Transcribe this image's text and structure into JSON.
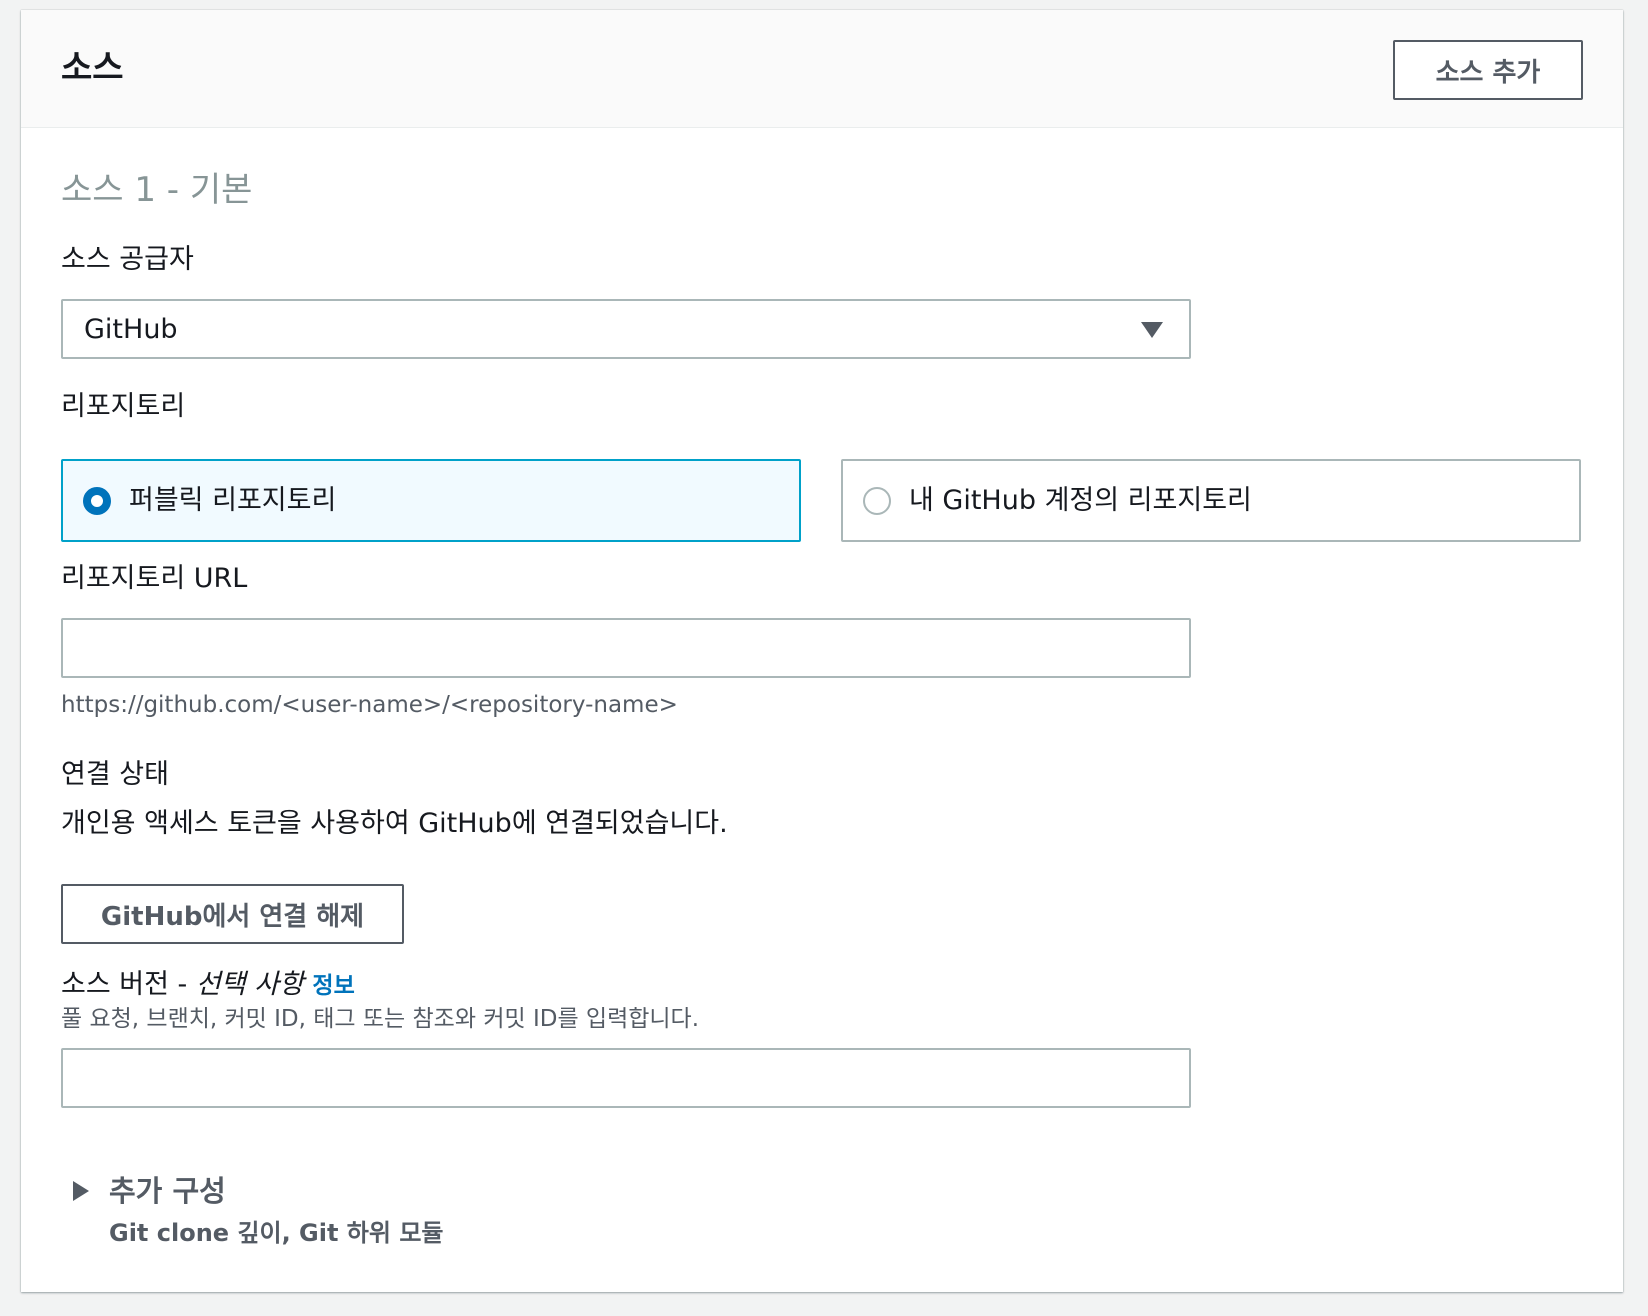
{
  "panel": {
    "title": "소스",
    "add_source_label": "소스 추가"
  },
  "source": {
    "subtitle": "소스 1 - 기본",
    "provider": {
      "label": "소스 공급자",
      "selected": "GitHub"
    },
    "repository": {
      "label": "리포지토리",
      "options": [
        {
          "label": "퍼블릭 리포지토리",
          "selected": true
        },
        {
          "label": "내 GitHub 계정의 리포지토리",
          "selected": false
        }
      ]
    },
    "repo_url": {
      "label": "리포지토리 URL",
      "value": "",
      "hint": "https://github.com/<user-name>/<repository-name>"
    },
    "connection": {
      "label": "연결 상태",
      "status_text": "개인용 액세스 토큰을 사용하여 GitHub에 연결되었습니다.",
      "disconnect_label": "GitHub에서 연결 해제"
    },
    "source_version": {
      "label": "소스 버전 -",
      "optional": "선택 사항",
      "info": "정보",
      "description": "풀 요청, 브랜치, 커밋 ID, 태그 또는 참조와 커밋 ID를 입력합니다.",
      "value": ""
    },
    "additional_config": {
      "title": "추가 구성",
      "description": "Git clone 깊이, Git 하위 모듈"
    }
  },
  "colors": {
    "selected_border": "#00a1c9",
    "selected_bg": "#f1faff",
    "radio_on": "#0073bb",
    "link": "#0073bb"
  }
}
